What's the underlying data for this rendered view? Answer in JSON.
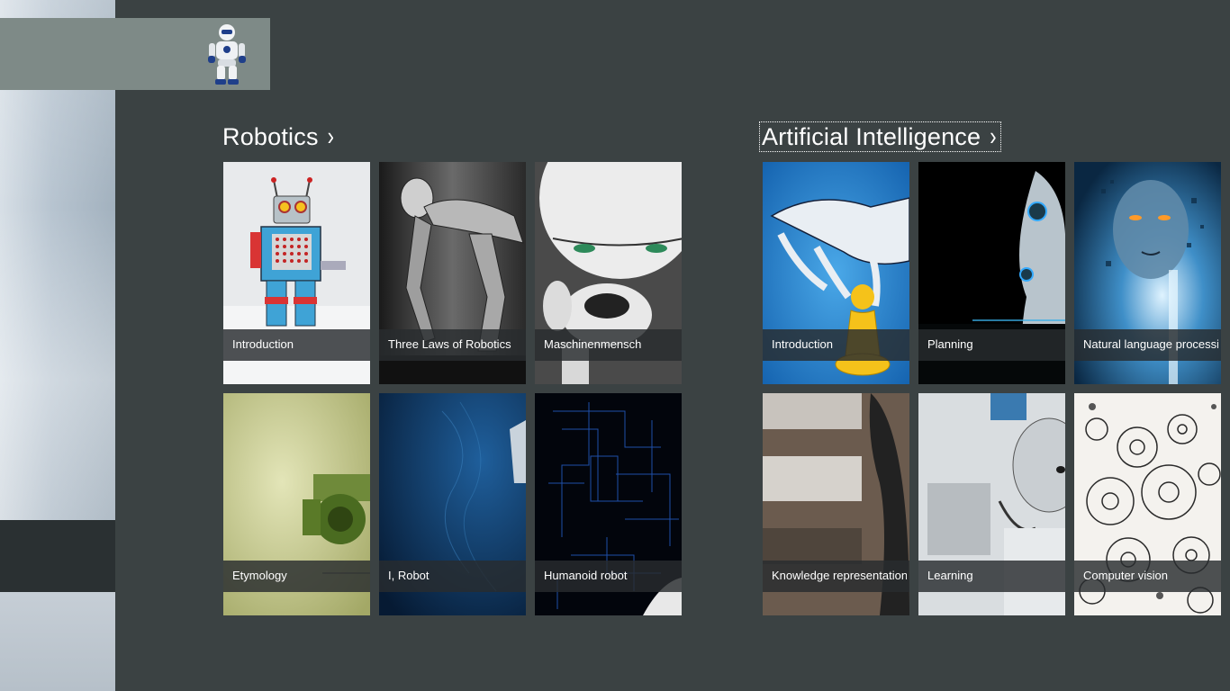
{
  "groups": [
    {
      "title": "Robotics",
      "chevron": "›",
      "tiles": [
        {
          "label": "Introduction"
        },
        {
          "label": "Three Laws of Robotics"
        },
        {
          "label": "Maschinenmensch"
        },
        {
          "label": "Etymology"
        },
        {
          "label": "I, Robot"
        },
        {
          "label": "Humanoid robot"
        }
      ]
    },
    {
      "title": "Artificial Intelligence",
      "chevron": "›",
      "tiles": [
        {
          "label": "Introduction"
        },
        {
          "label": "Planning"
        },
        {
          "label": "Natural language processing"
        },
        {
          "label": "Knowledge representation"
        },
        {
          "label": "Learning"
        },
        {
          "label": "Computer vision"
        }
      ]
    }
  ],
  "icons": {
    "logo": "robot-logo-icon",
    "chevron": "chevron-right-icon"
  },
  "colors": {
    "background": "#3b4243",
    "banner": "#7e8a87",
    "caption": "#282c2e"
  }
}
